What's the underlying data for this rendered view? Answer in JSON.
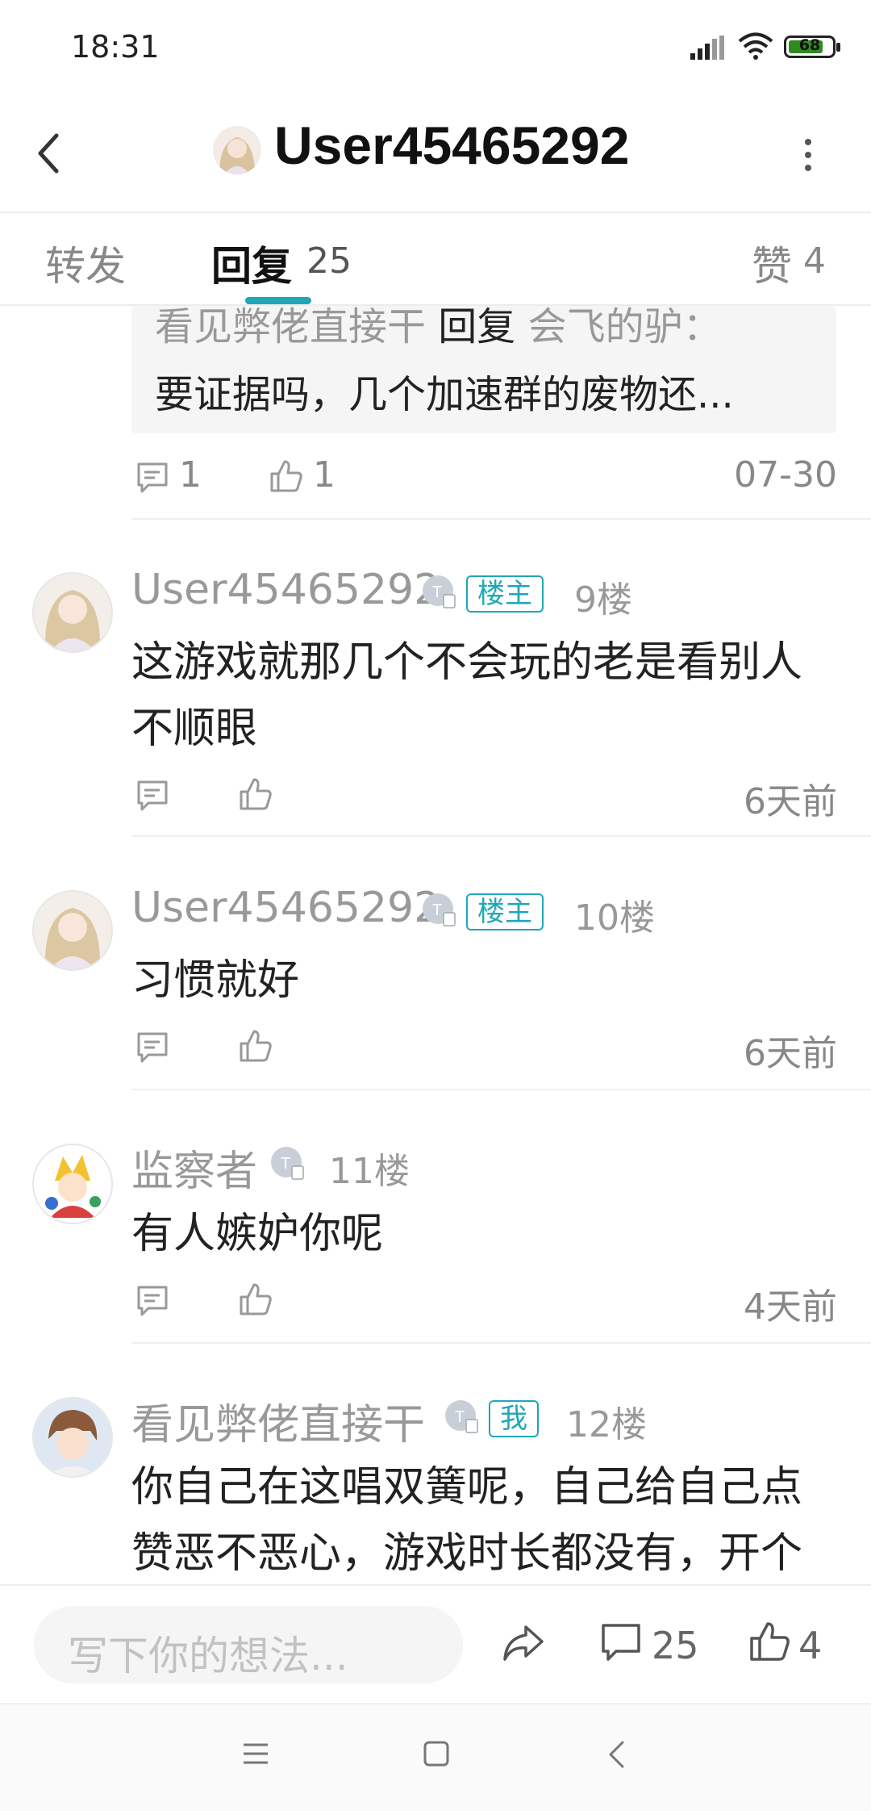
{
  "status_bar": {
    "time": "18:31",
    "battery": "68"
  },
  "header": {
    "title": "User45465292"
  },
  "tabs": [
    {
      "label": "转发"
    },
    {
      "label": "回复",
      "count": "25"
    },
    {
      "label": "赞",
      "count": "4"
    }
  ],
  "partial_reply": {
    "quote_author": "看见弊佬直接干",
    "quote_connector": "回复",
    "quote_target": "会飞的驴：",
    "quote_text": "要证据吗，几个加速群的废物还...",
    "comments": "1",
    "likes": "1",
    "date": "07-30"
  },
  "replies": [
    {
      "user": "User45465292",
      "tag": "楼主",
      "floor": "9楼",
      "lines": [
        "这游戏就那几个不会玩的老是看别人",
        "不顺眼"
      ],
      "date": "6天前"
    },
    {
      "user": "User45465292",
      "tag": "楼主",
      "floor": "10楼",
      "lines": [
        "习惯就好"
      ],
      "date": "6天前"
    },
    {
      "user": "监察者",
      "tag": "",
      "floor": "11楼",
      "lines": [
        "有人嫉妒你呢"
      ],
      "date": "4天前"
    },
    {
      "user": "看见弊佬直接干",
      "tag": "我",
      "floor": "12楼",
      "lines": [
        "你自己在这唱双簧呢，自己给自己点",
        "赞恶不恶心，游戏时长都没有，开个"
      ],
      "date": ""
    }
  ],
  "bottom_bar": {
    "placeholder": "写下你的想法...",
    "comment_count": "25",
    "like_count": "4"
  },
  "colors": {
    "accent": "#1fa8b8",
    "text_primary": "#222222",
    "text_secondary": "#999999"
  },
  "icons": [
    "back-icon",
    "more-icon",
    "comment-icon",
    "like-icon",
    "share-icon",
    "level-icon",
    "menu-icon",
    "home-icon",
    "back-nav-icon"
  ]
}
